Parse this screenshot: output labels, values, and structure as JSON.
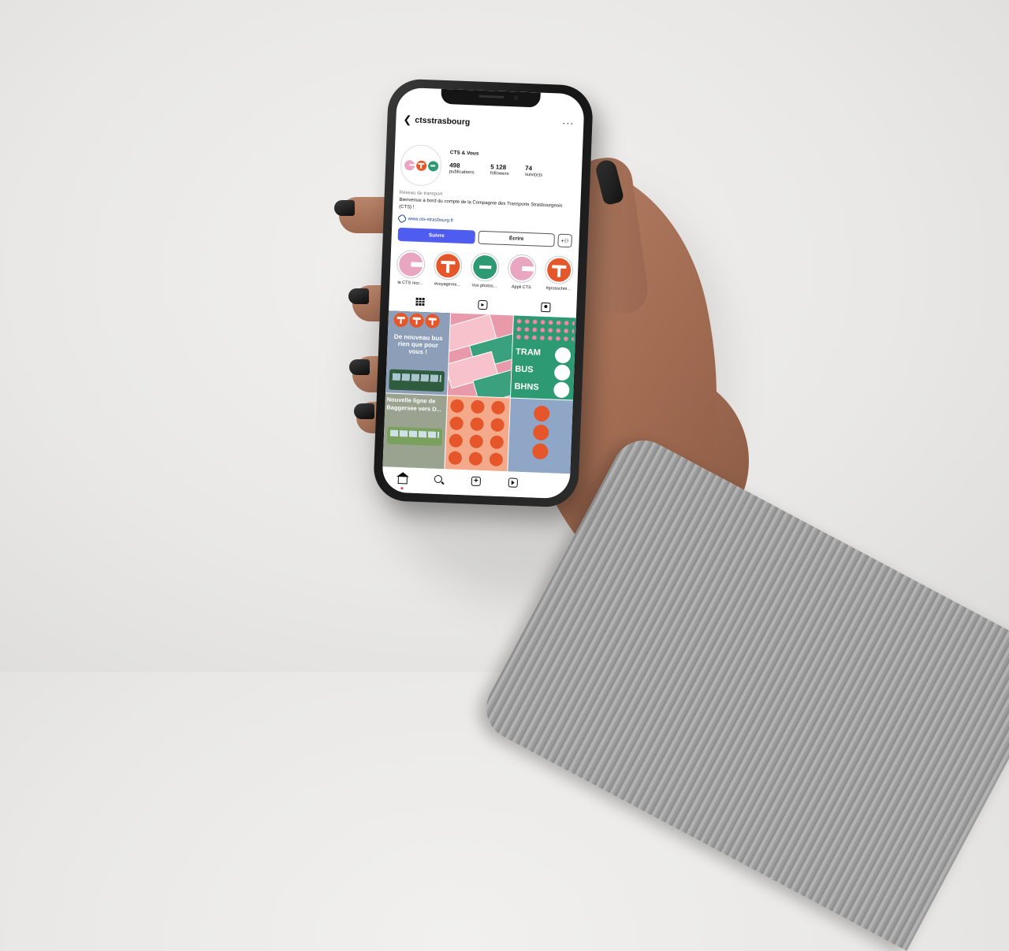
{
  "profile": {
    "username": "ctsstrasbourg",
    "display_name": "CTS & Vous",
    "stats": [
      {
        "value": "498",
        "label": "publications"
      },
      {
        "value": "5 128",
        "label": "followers"
      },
      {
        "value": "74",
        "label": "suivi(e)s"
      }
    ],
    "category": "Réseau de transport",
    "bio": "Bienvenue à bord du compte de la Compagnie des Transports Strasbourgeois (CTS) !",
    "link": "www.cts-strasbourg.fr"
  },
  "actions": {
    "follow_label": "Suivre",
    "message_label": "Écrire",
    "add_label": "+⚇"
  },
  "highlights": [
    {
      "label": "la CTS recr...",
      "mark": "c"
    },
    {
      "label": "#voyagermi...",
      "mark": "t"
    },
    {
      "label": "Vos photos...",
      "mark": "s"
    },
    {
      "label": "Appli CTS",
      "mark": "c"
    },
    {
      "label": "#grosschm...",
      "mark": "t"
    }
  ],
  "posts": {
    "post1_text": "De nouveau bus rien que pour vous !",
    "post3_lines": [
      "TRAM",
      "BUS",
      "BHNS"
    ],
    "post4_text": "Nouvelle ligne de Baggersee vers D..."
  },
  "icons": {
    "back": "chevron-left-icon",
    "more": "more-horizontal-icon",
    "link": "link-icon",
    "tabs": [
      "grid-icon",
      "reels-icon",
      "tagged-icon"
    ],
    "nav": [
      "home-icon",
      "search-icon",
      "add-post-icon",
      "reels-icon"
    ]
  },
  "colors": {
    "follow_button": "#4f5cf0",
    "brand_pink": "#e9a6c1",
    "brand_orange": "#e5562a",
    "brand_green": "#2e9a74"
  }
}
